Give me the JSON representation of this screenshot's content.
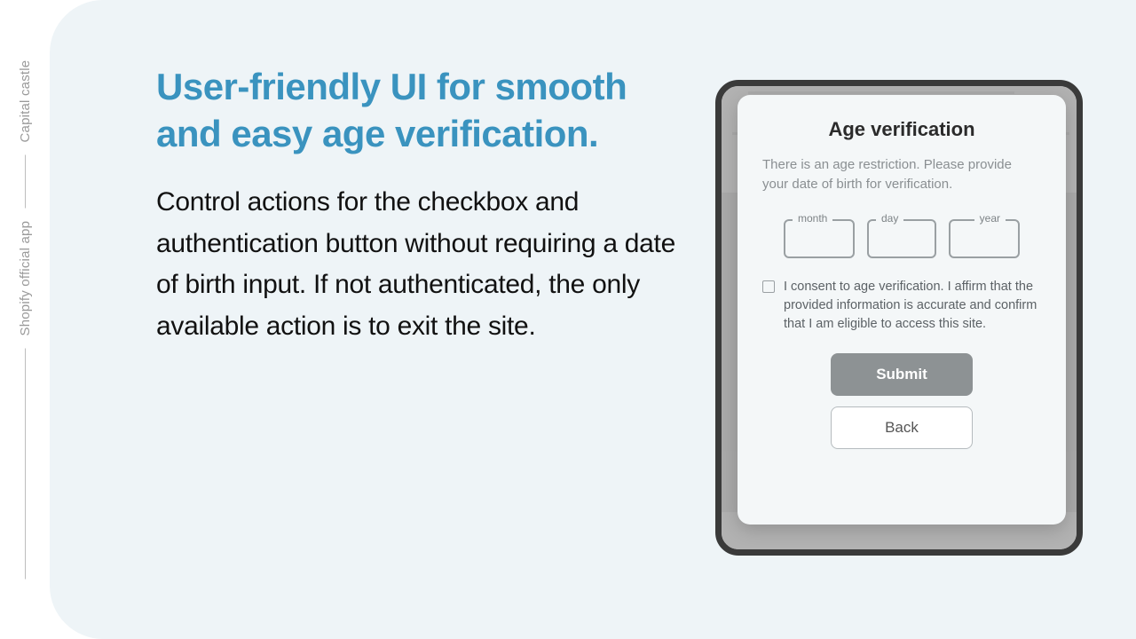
{
  "rail": {
    "top": "Capital castle",
    "bottom": "Shopify official app"
  },
  "copy": {
    "headline": "User-friendly UI for smooth and easy age verification.",
    "body": "Control actions for the checkbox and authentication button without requiring a date of birth input. If not authenticated, the only available action is to exit the site."
  },
  "modal": {
    "title": "Age verification",
    "description": "There is an age restriction. Please provide your date of birth for verification.",
    "fields": {
      "month": "month",
      "day": "day",
      "year": "year"
    },
    "consent": "I consent to age verification. I affirm that the provided information is accurate and confirm that I am eligible to access this site.",
    "submit": "Submit",
    "back": "Back"
  }
}
